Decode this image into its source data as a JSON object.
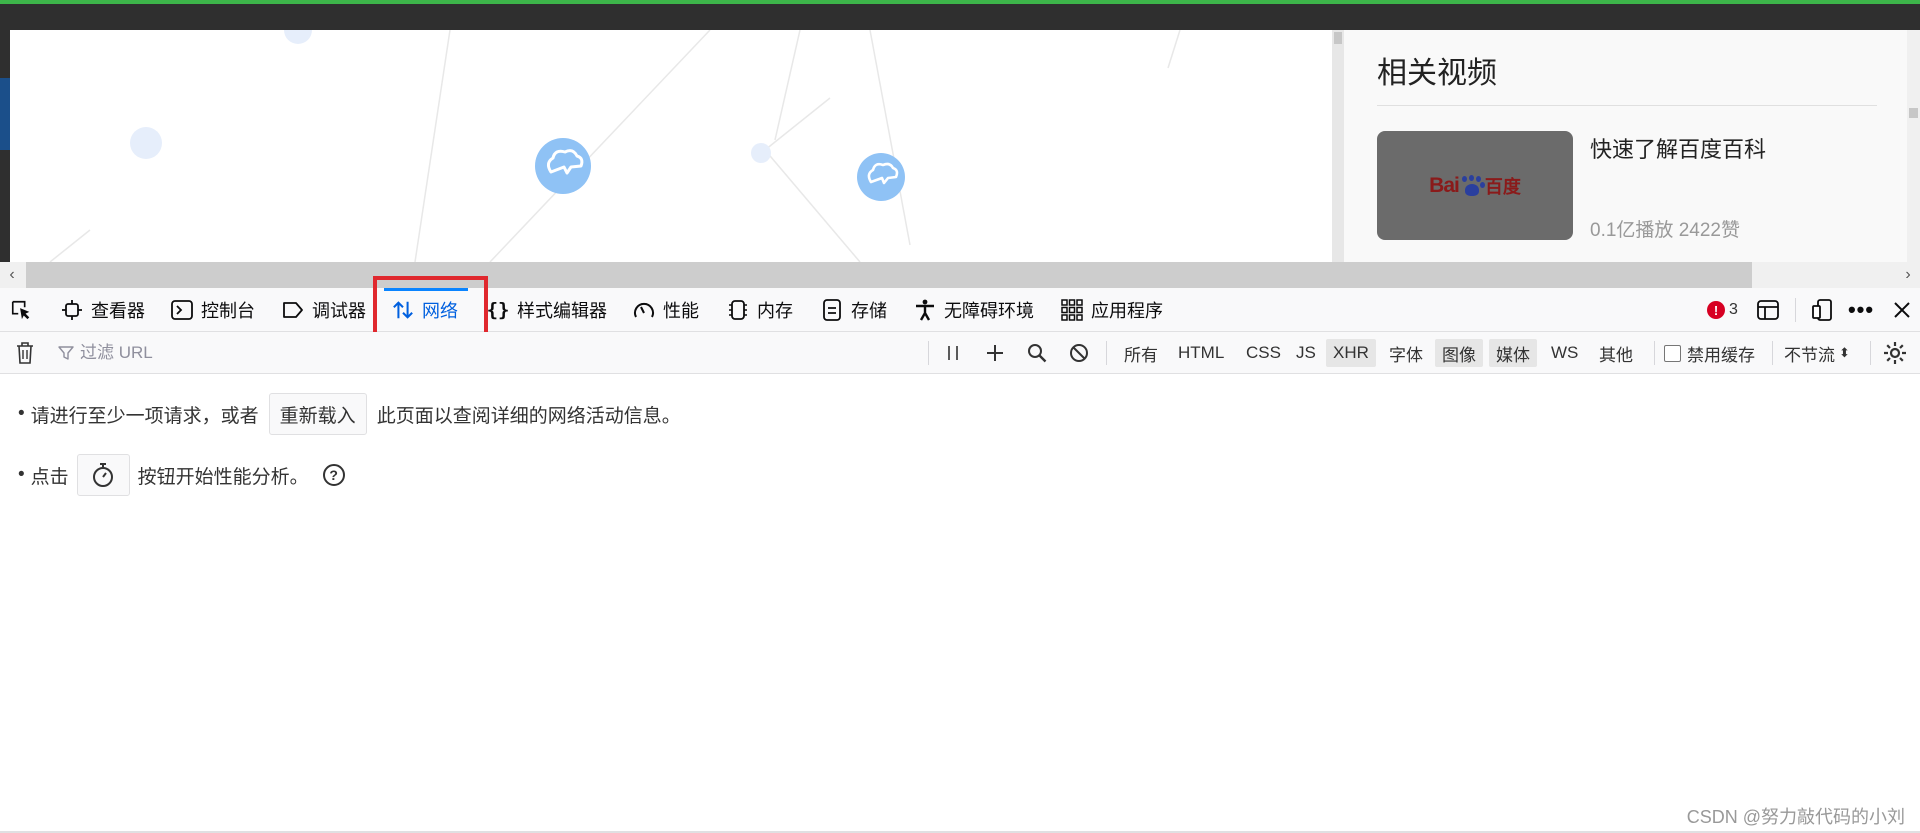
{
  "page": {
    "side_panel": {
      "title": "相关视频",
      "video": {
        "title": "快速了解百度百科",
        "meta": "0.1亿播放  2422赞",
        "thumb_logo_left": "Bai",
        "thumb_logo_right": "百度"
      }
    }
  },
  "toolbox": {
    "tools": [
      {
        "label": "查看器",
        "icon": "inspector-icon"
      },
      {
        "label": "控制台",
        "icon": "console-icon"
      },
      {
        "label": "调试器",
        "icon": "debugger-icon"
      },
      {
        "label": "网络",
        "icon": "network-arrows-icon",
        "selected": true
      },
      {
        "label": "样式编辑器",
        "icon": "braces-icon"
      },
      {
        "label": "性能",
        "icon": "gauge-icon"
      },
      {
        "label": "内存",
        "icon": "memory-chip-icon"
      },
      {
        "label": "存储",
        "icon": "storage-icon"
      },
      {
        "label": "无障碍环境",
        "icon": "accessibility-icon"
      },
      {
        "label": "应用程序",
        "icon": "app-grid-icon"
      }
    ],
    "error_count": "3",
    "highlight_color": "#e0282e",
    "accent_color": "#0a84ff"
  },
  "network_toolbar": {
    "filter_placeholder": "过滤 URL",
    "type_filters": [
      {
        "label": "所有",
        "checked": false
      },
      {
        "label": "HTML",
        "checked": false
      },
      {
        "label": "CSS",
        "checked": false
      },
      {
        "label": "JS",
        "checked": false
      },
      {
        "label": "XHR",
        "checked": true
      },
      {
        "label": "字体",
        "checked": false
      },
      {
        "label": "图像",
        "checked": true
      },
      {
        "label": "媒体",
        "checked": true
      },
      {
        "label": "WS",
        "checked": false
      },
      {
        "label": "其他",
        "checked": false
      }
    ],
    "disable_cache_label": "禁用缓存",
    "throttle_label": "不节流",
    "throttle_arrows": "⬍"
  },
  "empty_notice": {
    "line1_prefix": "请进行至少一项请求，或者",
    "reload_label": "重新载入",
    "line1_suffix": "此页面以查阅详细的网络活动信息。",
    "line2_prefix": "点击",
    "line2_suffix": "按钮开始性能分析。",
    "help_glyph": "?"
  },
  "watermark": "CSDN @努力敲代码的小刘"
}
